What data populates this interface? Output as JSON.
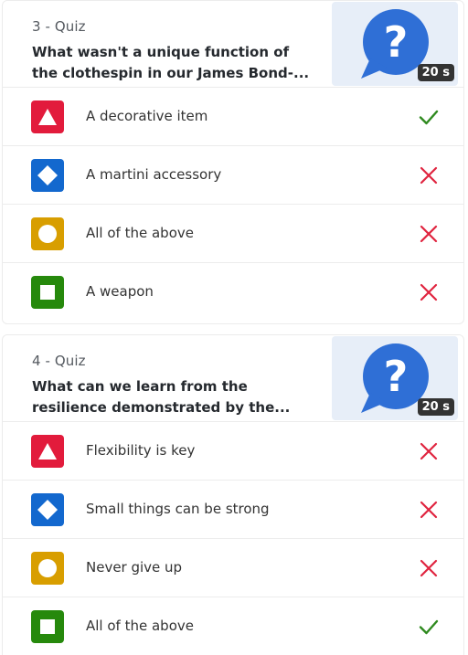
{
  "questions": [
    {
      "label": "3 - Quiz",
      "title_line1": "What wasn't a unique function of",
      "title_line2": "the clothespin in our James Bond-...",
      "time": "20 s",
      "options": [
        {
          "text": "A decorative item",
          "shape": "triangle-icon",
          "color": "#e21b3c",
          "correct": true
        },
        {
          "text": "A martini accessory",
          "shape": "diamond-icon",
          "color": "#1368ce",
          "correct": false
        },
        {
          "text": "All of the above",
          "shape": "circle-icon",
          "color": "#d89e00",
          "correct": false
        },
        {
          "text": "A weapon",
          "shape": "square-icon",
          "color": "#26890c",
          "correct": false
        }
      ]
    },
    {
      "label": "4 - Quiz",
      "title_line1": "What can we learn from the",
      "title_line2": "resilience demonstrated by the...",
      "time": "20 s",
      "options": [
        {
          "text": "Flexibility is key",
          "shape": "triangle-icon",
          "color": "#e21b3c",
          "correct": false
        },
        {
          "text": "Small things can be strong",
          "shape": "diamond-icon",
          "color": "#1368ce",
          "correct": false
        },
        {
          "text": "Never give up",
          "shape": "circle-icon",
          "color": "#d89e00",
          "correct": false
        },
        {
          "text": "All of the above",
          "shape": "square-icon",
          "color": "#26890c",
          "correct": true
        }
      ]
    }
  ],
  "colors": {
    "correct": "#2f8a1f",
    "incorrect": "#e0243f",
    "thumbnail_bubble": "#2f6fd6"
  }
}
